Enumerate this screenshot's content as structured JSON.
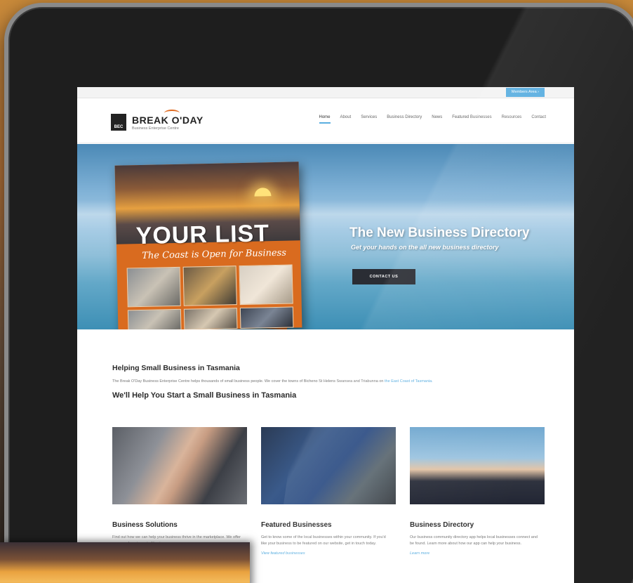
{
  "utilbar": {
    "members_label": "Members Area"
  },
  "header": {
    "logo_mark": "BEC",
    "logo_title": "BREAK O'DAY",
    "logo_subtitle": "Business Enterprise Centre",
    "nav": [
      {
        "label": "Home",
        "active": true
      },
      {
        "label": "About"
      },
      {
        "label": "Services"
      },
      {
        "label": "Business Directory"
      },
      {
        "label": "News"
      },
      {
        "label": "Featured Businesses"
      },
      {
        "label": "Resources"
      },
      {
        "label": "Contact"
      }
    ]
  },
  "hero": {
    "brochure_title": "YOUR LIST",
    "brochure_subtitle": "The Coast is Open for Business",
    "title": "The New Business Directory",
    "subtitle": "Get your hands on the all new business directory",
    "button_label": "CONTACT US"
  },
  "intro": {
    "heading": "Helping Small Business in Tasmania",
    "paragraph": "The Break O'Day Business Enterprise Centre helps thousands of small business people. We cover the towns of Bicheno St Helens Swansea and Triabunna on",
    "paragraph_link": "the East Coast of Tasmania.",
    "heading2": "We'll Help You Start a Small Business in Tasmania"
  },
  "cards": [
    {
      "title": "Business Solutions",
      "text": "Find out how we can help your business thrive in the marketplace. We offer a comprehensive set of business",
      "link": ""
    },
    {
      "title": "Featured Businesses",
      "text": "Get to know some of the local businesses within your community. If you'd like your business to be featured on our website, get in touch today.",
      "link": "View featured businesses"
    },
    {
      "title": "Business Directory",
      "text": "Our business community directory app helps local businesses connect and be found. Learn more about how our app can help your business.",
      "link": "Learn more"
    }
  ]
}
